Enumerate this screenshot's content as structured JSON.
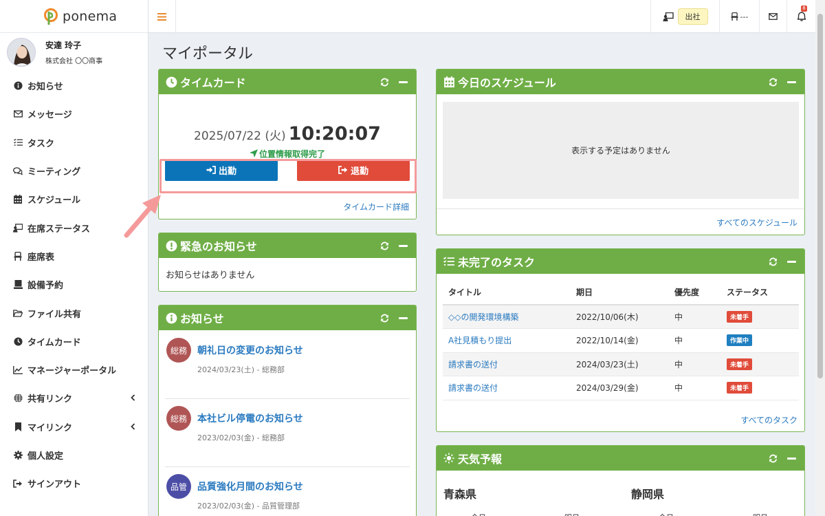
{
  "app": {
    "name": "ponema"
  },
  "user": {
    "name": "安達 玲子",
    "company": "株式会社 〇〇商事"
  },
  "sidebar": {
    "items": [
      {
        "label": "お知らせ",
        "icon": "info-icon"
      },
      {
        "label": "メッセージ",
        "icon": "envelope-icon"
      },
      {
        "label": "タスク",
        "icon": "tasks-icon"
      },
      {
        "label": "ミーティング",
        "icon": "comments-icon"
      },
      {
        "label": "スケジュール",
        "icon": "calendar-icon"
      },
      {
        "label": "在席ステータス",
        "icon": "presence-icon"
      },
      {
        "label": "座席表",
        "icon": "chair-icon"
      },
      {
        "label": "設備予約",
        "icon": "equipment-icon"
      },
      {
        "label": "ファイル共有",
        "icon": "folder-icon"
      },
      {
        "label": "タイムカード",
        "icon": "clock-icon"
      },
      {
        "label": "マネージャーポータル",
        "icon": "chart-icon"
      },
      {
        "label": "共有リンク",
        "icon": "globe-icon"
      },
      {
        "label": "マイリンク",
        "icon": "bookmark-icon"
      },
      {
        "label": "個人設定",
        "icon": "gear-icon"
      },
      {
        "label": "サインアウト",
        "icon": "signout-icon"
      }
    ]
  },
  "topbar": {
    "status_label": "出社",
    "seat_label": "---",
    "notification_count": "8"
  },
  "page": {
    "title": "マイポータル"
  },
  "timecard": {
    "title": "タイムカード",
    "date": "2025/07/22 (火)",
    "time": "10:20:07",
    "geo_status": "位置情報取得完了",
    "clock_in_label": "出勤",
    "clock_out_label": "退勤",
    "detail_link": "タイムカード詳細"
  },
  "urgent": {
    "title": "緊急のお知らせ",
    "empty_text": "お知らせはありません"
  },
  "news": {
    "title": "お知らせ",
    "items": [
      {
        "badge": "総務",
        "badge_color": "#b05555",
        "title": "朝礼日の変更のお知らせ",
        "meta": "2024/03/23(土) - 総務部"
      },
      {
        "badge": "総務",
        "badge_color": "#b05555",
        "title": "本社ビル停電のお知らせ",
        "meta": "2023/02/03(金) - 総務部"
      },
      {
        "badge": "品管",
        "badge_color": "#4c4ea6",
        "title": "品質強化月間のお知らせ",
        "meta": "2023/02/03(金) - 品質管理部"
      }
    ]
  },
  "schedule": {
    "title": "今日のスケジュール",
    "empty_text": "表示する予定はありません",
    "all_link": "すべてのスケジュール"
  },
  "tasks": {
    "title": "未完了のタスク",
    "columns": [
      "タイトル",
      "期日",
      "優先度",
      "ステータス"
    ],
    "rows": [
      {
        "title": "◇◇の開発環境構築",
        "due": "2022/10/06(木)",
        "priority": "中",
        "status": "未着手",
        "status_color": "#e04b3a"
      },
      {
        "title": "A社見積もり提出",
        "due": "2022/10/14(金)",
        "priority": "中",
        "status": "作業中",
        "status_color": "#1f7fc0"
      },
      {
        "title": "請求書の送付",
        "due": "2024/03/23(土)",
        "priority": "中",
        "status": "未着手",
        "status_color": "#e04b3a"
      },
      {
        "title": "請求書の送付",
        "due": "2024/03/29(金)",
        "priority": "中",
        "status": "未着手",
        "status_color": "#e04b3a"
      }
    ],
    "all_link": "すべてのタスク"
  },
  "weather": {
    "title": "天気予報",
    "prefectures": [
      "青森県",
      "静岡県"
    ],
    "day_labels": [
      "今日",
      "明日"
    ]
  },
  "colors": {
    "panel_header": "#6fae46",
    "link": "#2a7ac0",
    "clock_in": "#0b74b9",
    "clock_out": "#e04b3a",
    "highlight": "#f59a9a"
  }
}
